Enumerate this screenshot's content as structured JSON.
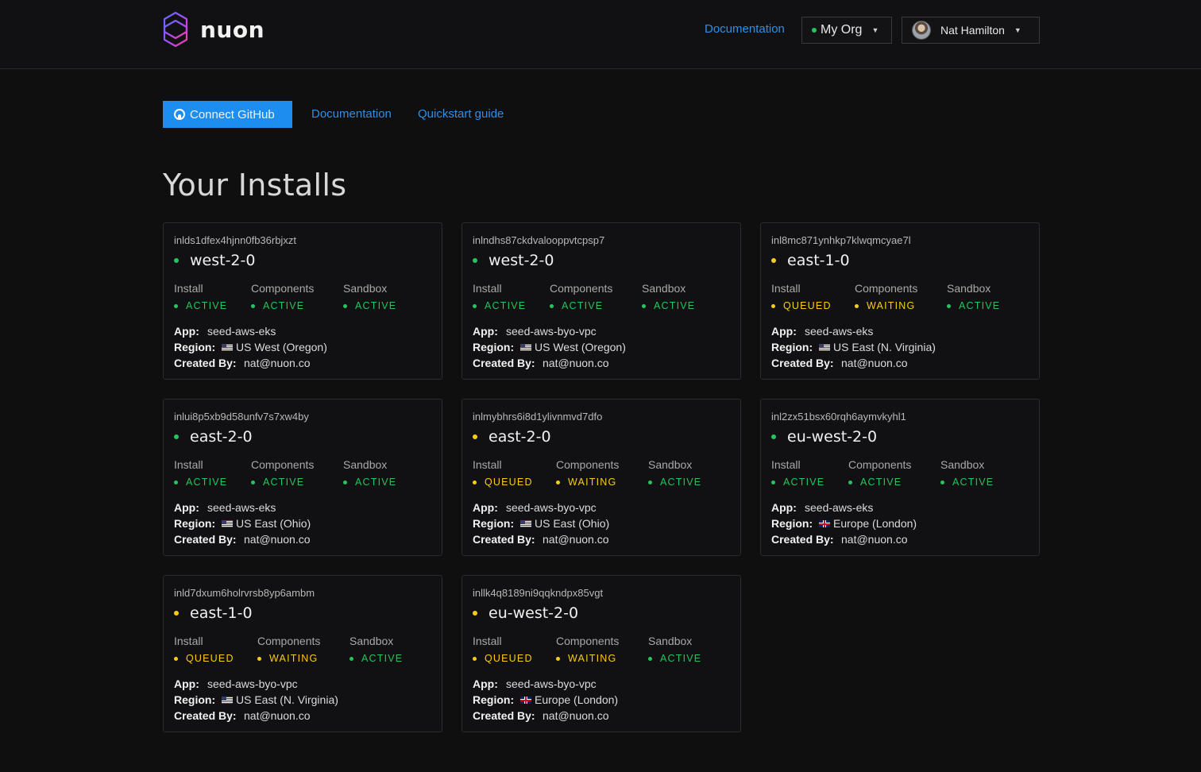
{
  "header": {
    "brand": "nuon",
    "nav_documentation": "Documentation",
    "org": {
      "label": "My Org"
    },
    "user": {
      "name": "Nat Hamilton"
    }
  },
  "actions": {
    "connect_github": "Connect GitHub",
    "documentation": "Documentation",
    "quickstart": "Quickstart guide"
  },
  "page_title": "Your Installs",
  "labels": {
    "install": "Install",
    "components": "Components",
    "sandbox": "Sandbox",
    "app": "App:",
    "region": "Region:",
    "created_by": "Created By:"
  },
  "colors": {
    "active": "#22c55e",
    "queued": "#facc15",
    "waiting": "#facc15",
    "link": "#2f8fe6",
    "button": "#1d8ef0"
  },
  "installs": [
    {
      "id": "inlds1dfex4hjnn0fb36rbjxzt",
      "name": "west-2-0",
      "status": "active",
      "install": "ACTIVE",
      "components": "ACTIVE",
      "sandbox": "ACTIVE",
      "app": "seed-aws-eks",
      "flag": "us",
      "region": "US West (Oregon)",
      "created_by": "nat@nuon.co"
    },
    {
      "id": "inlndhs87ckdvalooppvtcpsp7",
      "name": "west-2-0",
      "status": "active",
      "install": "ACTIVE",
      "components": "ACTIVE",
      "sandbox": "ACTIVE",
      "app": "seed-aws-byo-vpc",
      "flag": "us",
      "region": "US West (Oregon)",
      "created_by": "nat@nuon.co"
    },
    {
      "id": "inl8mc871ynhkp7klwqmcyae7l",
      "name": "east-1-0",
      "status": "queued",
      "install": "QUEUED",
      "components": "WAITING",
      "sandbox": "ACTIVE",
      "app": "seed-aws-eks",
      "flag": "us",
      "region": "US East (N. Virginia)",
      "created_by": "nat@nuon.co"
    },
    {
      "id": "inlui8p5xb9d58unfv7s7xw4by",
      "name": "east-2-0",
      "status": "active",
      "install": "ACTIVE",
      "components": "ACTIVE",
      "sandbox": "ACTIVE",
      "app": "seed-aws-eks",
      "flag": "us",
      "region": "US East (Ohio)",
      "created_by": "nat@nuon.co"
    },
    {
      "id": "inlmybhrs6i8d1ylivnmvd7dfo",
      "name": "east-2-0",
      "status": "queued",
      "install": "QUEUED",
      "components": "WAITING",
      "sandbox": "ACTIVE",
      "app": "seed-aws-byo-vpc",
      "flag": "us",
      "region": "US East (Ohio)",
      "created_by": "nat@nuon.co"
    },
    {
      "id": "inl2zx51bsx60rqh6aymvkyhl1",
      "name": "eu-west-2-0",
      "status": "active",
      "install": "ACTIVE",
      "components": "ACTIVE",
      "sandbox": "ACTIVE",
      "app": "seed-aws-eks",
      "flag": "gb",
      "region": "Europe (London)",
      "created_by": "nat@nuon.co"
    },
    {
      "id": "inld7dxum6holrvrsb8yp6ambm",
      "name": "east-1-0",
      "status": "queued",
      "install": "QUEUED",
      "components": "WAITING",
      "sandbox": "ACTIVE",
      "app": "seed-aws-byo-vpc",
      "flag": "us",
      "region": "US East (N. Virginia)",
      "created_by": "nat@nuon.co"
    },
    {
      "id": "inllk4q8189ni9qqkndpx85vgt",
      "name": "eu-west-2-0",
      "status": "queued",
      "install": "QUEUED",
      "components": "WAITING",
      "sandbox": "ACTIVE",
      "app": "seed-aws-byo-vpc",
      "flag": "gb",
      "region": "Europe (London)",
      "created_by": "nat@nuon.co"
    }
  ]
}
